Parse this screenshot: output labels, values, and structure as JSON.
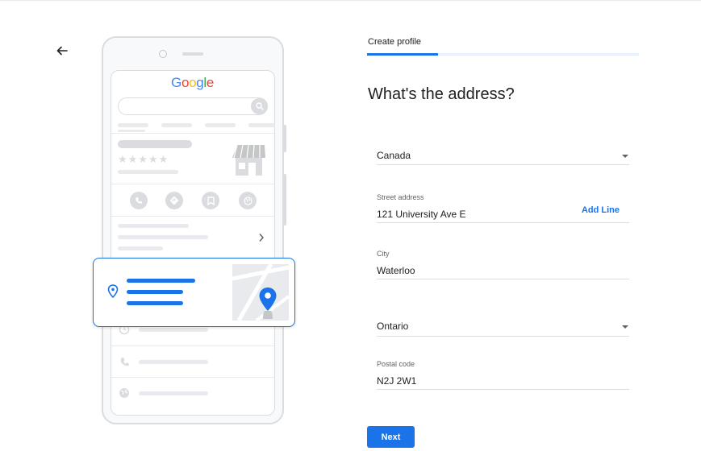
{
  "header": {
    "step_label": "Create profile",
    "progress": 0.26
  },
  "form": {
    "title": "What's the address?",
    "country": {
      "value": "Canada"
    },
    "street": {
      "label": "Street address",
      "value": "121 University Ave E",
      "add_line_label": "Add Line"
    },
    "city": {
      "label": "City",
      "value": "Waterloo"
    },
    "province": {
      "value": "Ontario"
    },
    "postal": {
      "label": "Postal code",
      "value": "N2J 2W1"
    },
    "next_label": "Next"
  },
  "illustration": {
    "logo_letters": [
      "G",
      "o",
      "o",
      "g",
      "l",
      "e"
    ],
    "logo_colors": [
      "#4285F4",
      "#EA4335",
      "#FBBC05",
      "#4285F4",
      "#34A853",
      "#EA4335"
    ],
    "stars": "★★★★★"
  },
  "colors": {
    "accent": "#1a73e8",
    "placeholder_grey": "#dadce0"
  },
  "icons": [
    "back-arrow-icon",
    "search-icon",
    "storefront-icon",
    "phone-icon",
    "directions-icon",
    "bookmark-icon",
    "web-icon",
    "chevron-right-icon",
    "location-pin-icon",
    "map-pin-icon",
    "clock-icon",
    "globe-icon",
    "dropdown-arrow-icon"
  ]
}
